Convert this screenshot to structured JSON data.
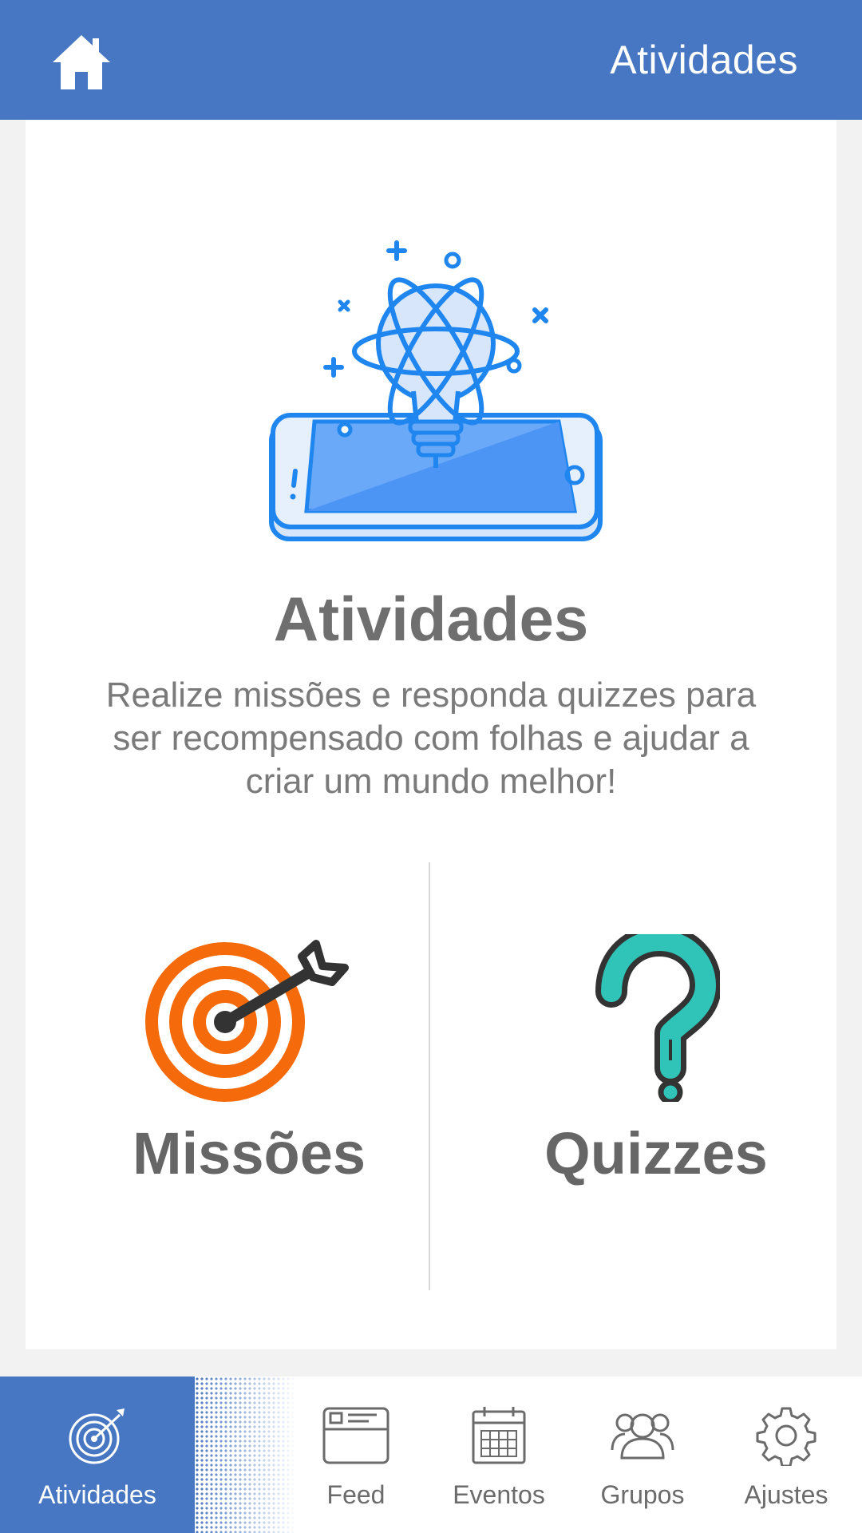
{
  "header": {
    "title": "Atividades",
    "home_icon": "home-icon",
    "background": "#4777c3"
  },
  "main": {
    "heading": "Atividades",
    "description": "Realize missões e responda quizzes para ser recompensado com folhas e ajudar a criar um mundo melhor!",
    "hero_icon": "lightbulb-phone-illustration",
    "options": [
      {
        "label": "Missões",
        "icon": "target-icon",
        "color": "#f56a0a"
      },
      {
        "label": "Quizzes",
        "icon": "question-mark-icon",
        "color": "#2fc4b7"
      }
    ]
  },
  "bottom_nav": {
    "items": [
      {
        "label": "Atividades",
        "icon": "target-icon",
        "active": true
      },
      {
        "label": "Feed",
        "icon": "browser-window-icon",
        "active": false
      },
      {
        "label": "Eventos",
        "icon": "calendar-icon",
        "active": false
      },
      {
        "label": "Grupos",
        "icon": "users-icon",
        "active": false
      },
      {
        "label": "Ajustes",
        "icon": "gear-icon",
        "active": false
      }
    ]
  }
}
